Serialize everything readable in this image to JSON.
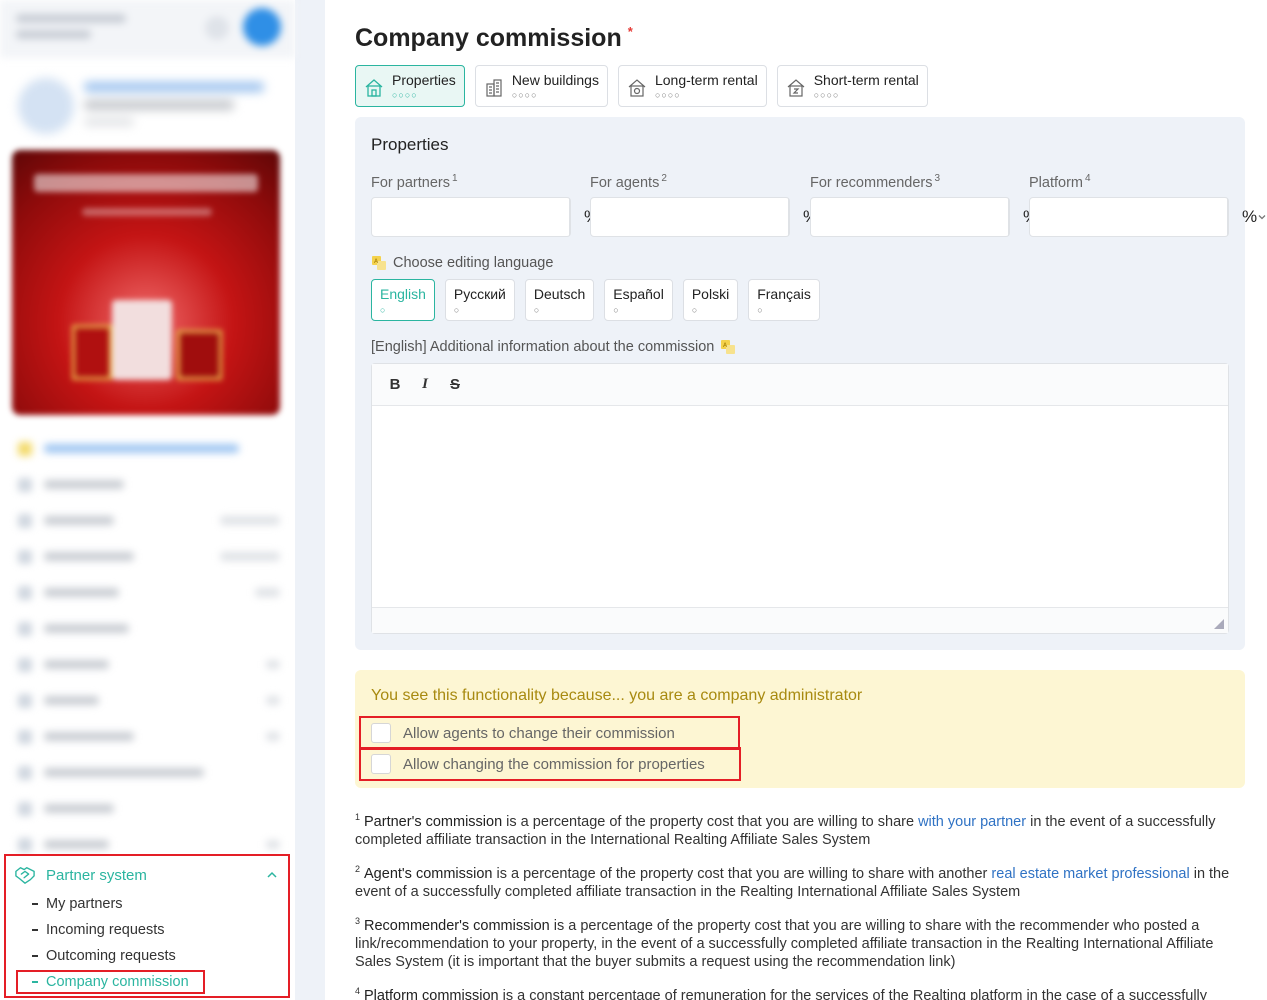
{
  "sidebar": {
    "partner_system": {
      "title": "Partner system",
      "items": [
        {
          "label": "My partners"
        },
        {
          "label": "Incoming requests"
        },
        {
          "label": "Outcoming requests"
        },
        {
          "label": "Company commission"
        }
      ]
    }
  },
  "main": {
    "title": "Company commission",
    "required_mark": "*",
    "type_tabs": [
      {
        "label": "Properties",
        "dots": "○○○○",
        "icon": "house-icon"
      },
      {
        "label": "New buildings",
        "dots": "○○○○",
        "icon": "building-icon"
      },
      {
        "label": "Long-term rental",
        "dots": "○○○○",
        "icon": "house-key-icon"
      },
      {
        "label": "Short-term rental",
        "dots": "○○○○",
        "icon": "house-clock-icon"
      }
    ],
    "panel": {
      "title": "Properties",
      "fields": [
        {
          "label": "For partners",
          "sup": "1",
          "value": "",
          "unit": "%"
        },
        {
          "label": "For agents",
          "sup": "2",
          "value": "",
          "unit": "%"
        },
        {
          "label": "For recommenders",
          "sup": "3",
          "value": "",
          "unit": "%"
        },
        {
          "label": "Platform",
          "sup": "4",
          "value": "",
          "unit": "%"
        }
      ],
      "language_label": "Choose editing language",
      "languages": [
        {
          "label": "English",
          "dot": "○"
        },
        {
          "label": "Русский",
          "dot": "○"
        },
        {
          "label": "Deutsch",
          "dot": "○"
        },
        {
          "label": "Español",
          "dot": "○"
        },
        {
          "label": "Polski",
          "dot": "○"
        },
        {
          "label": "Français",
          "dot": "○"
        }
      ],
      "additional_info_label": "[English] Additional information about the commission",
      "toolbar": {
        "bold": "B",
        "italic": "I",
        "strike": "S"
      }
    },
    "notice": {
      "title": "You see this functionality because... you are a company administrator",
      "checkboxes": [
        {
          "label": "Allow agents to change their commission",
          "checked": false
        },
        {
          "label": "Allow changing the commission for properties",
          "checked": false
        }
      ]
    },
    "notes": [
      {
        "num": "1",
        "term": "Partner's commission",
        "pre": " is a percentage of the property cost that you are willing to share ",
        "link": "with your partner",
        "post": " in the event of a successfully completed affiliate transaction in the International Realting Affiliate Sales System"
      },
      {
        "num": "2",
        "term": "Agent's commission",
        "pre": " is a percentage of the property cost that you are willing to share with another ",
        "link": "real estate market professional",
        "post": " in the event of a successfully completed affiliate transaction in the Realting International Affiliate Sales System"
      },
      {
        "num": "3",
        "term": "Recommender's commission",
        "pre": " is a percentage of the property cost that you are willing to share with the recommender who posted a link/recommendation to your property, in the event of a successfully completed affiliate transaction in the Realting International Affiliate Sales System (it is important that the buyer submits a request using the recommendation link)",
        "link": "",
        "post": ""
      },
      {
        "num": "4",
        "term": "Platform commission",
        "pre": " is a constant percentage of remuneration for the services of the Realting platform in the case of a successfully completed real estate transaction",
        "link": "",
        "post": ""
      }
    ]
  },
  "colors": {
    "accent": "#2bb5a0",
    "highlight_border": "#e41e26",
    "notice_bg": "#fdf6d3",
    "notice_text": "#a88a10",
    "link": "#2f72c4"
  }
}
